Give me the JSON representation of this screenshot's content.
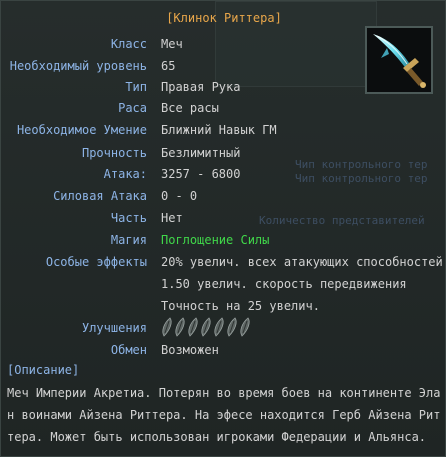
{
  "item": {
    "title": "[Клинок Риттера]",
    "icon": "sword-icon"
  },
  "background_text": [
    "Чип контрольного тер",
    "Чип контрольного тер",
    "Количество представителей"
  ],
  "stats": {
    "class": {
      "label": "Класс",
      "value": "Меч"
    },
    "level": {
      "label": "Необходимый уровень",
      "value": "65"
    },
    "type": {
      "label": "Тип",
      "value": "Правая Рука"
    },
    "race": {
      "label": "Раса",
      "value": "Все расы"
    },
    "skill": {
      "label": "Необходимое Умение",
      "value": "Ближний Навык ГМ"
    },
    "durability": {
      "label": "Прочность",
      "value": "Безлимитный"
    },
    "attack": {
      "label": "Атака:",
      "value": "3257 - 6800"
    },
    "power_attack": {
      "label": "Силовая Атака",
      "value": "0 - 0"
    },
    "part": {
      "label": "Часть",
      "value": "Нет"
    },
    "magic": {
      "label": "Магия",
      "value": "Поглощение Силы"
    },
    "effects": {
      "label": "Особые эффекты",
      "lines": [
        "20% увелич. всех атакующих способностей",
        "1.50 увелич. скорость передвижения",
        "Точность на 25 увелич."
      ]
    },
    "upgrades": {
      "label": "Улучшения",
      "slots_total": 7,
      "slots_filled": 0,
      "slot_icon": "empty-upgrade-slot-icon"
    },
    "trade": {
      "label": "Обмен",
      "value": "Возможен"
    }
  },
  "description": {
    "header": "[Описание]",
    "lines": [
      "Меч Империи Акретиа. Потерян во время боев на континенте Эла",
      "н воинами Айзена Риттера. На эфесе находится Герб Айзена Рит",
      "тера. Может быть использован игроками Федерации и Альянса."
    ]
  },
  "colors": {
    "title": "#e8a64a",
    "label": "#8db4e6",
    "value": "#d2d2d2",
    "magic": "#40d84a"
  }
}
